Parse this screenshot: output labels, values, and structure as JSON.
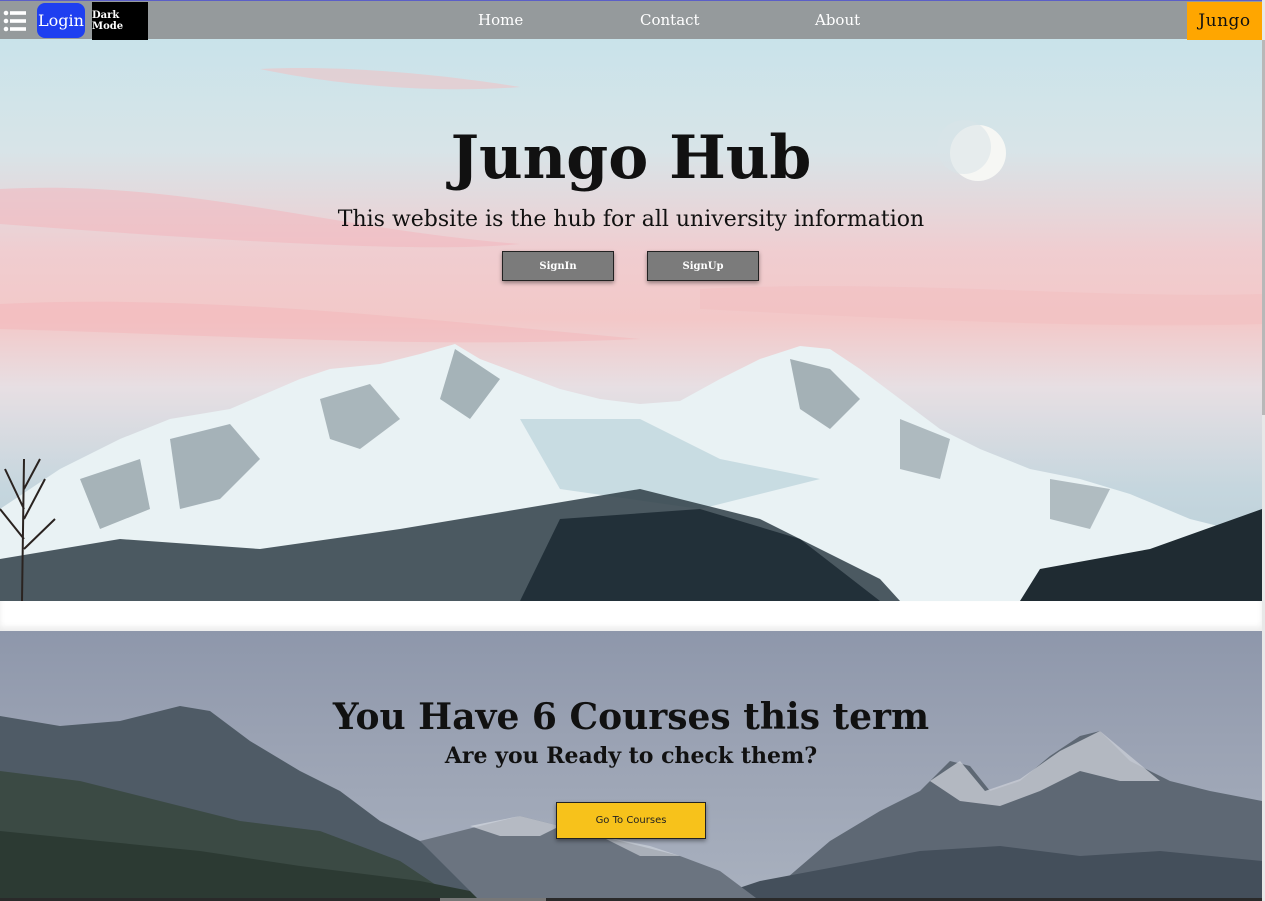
{
  "navbar": {
    "menu_icon": "list-icon",
    "login_label": "Login",
    "dark_mode_label": "Dark Mode",
    "links": [
      "Home",
      "Contact",
      "About"
    ],
    "brand": "Jungo",
    "colors": {
      "bar": "#959a9c",
      "login": "#1e3ff0",
      "brand": "#ffa600"
    }
  },
  "hero": {
    "title": "Jungo Hub",
    "subtitle": "This website is the hub for all university information",
    "buttons": [
      "SignIn",
      "SignUp"
    ]
  },
  "courses_section": {
    "title": "You Have 6 Courses this term",
    "subtitle": "Are you Ready to check them?",
    "button": "Go To Courses",
    "button_color": "#f7c21b"
  }
}
